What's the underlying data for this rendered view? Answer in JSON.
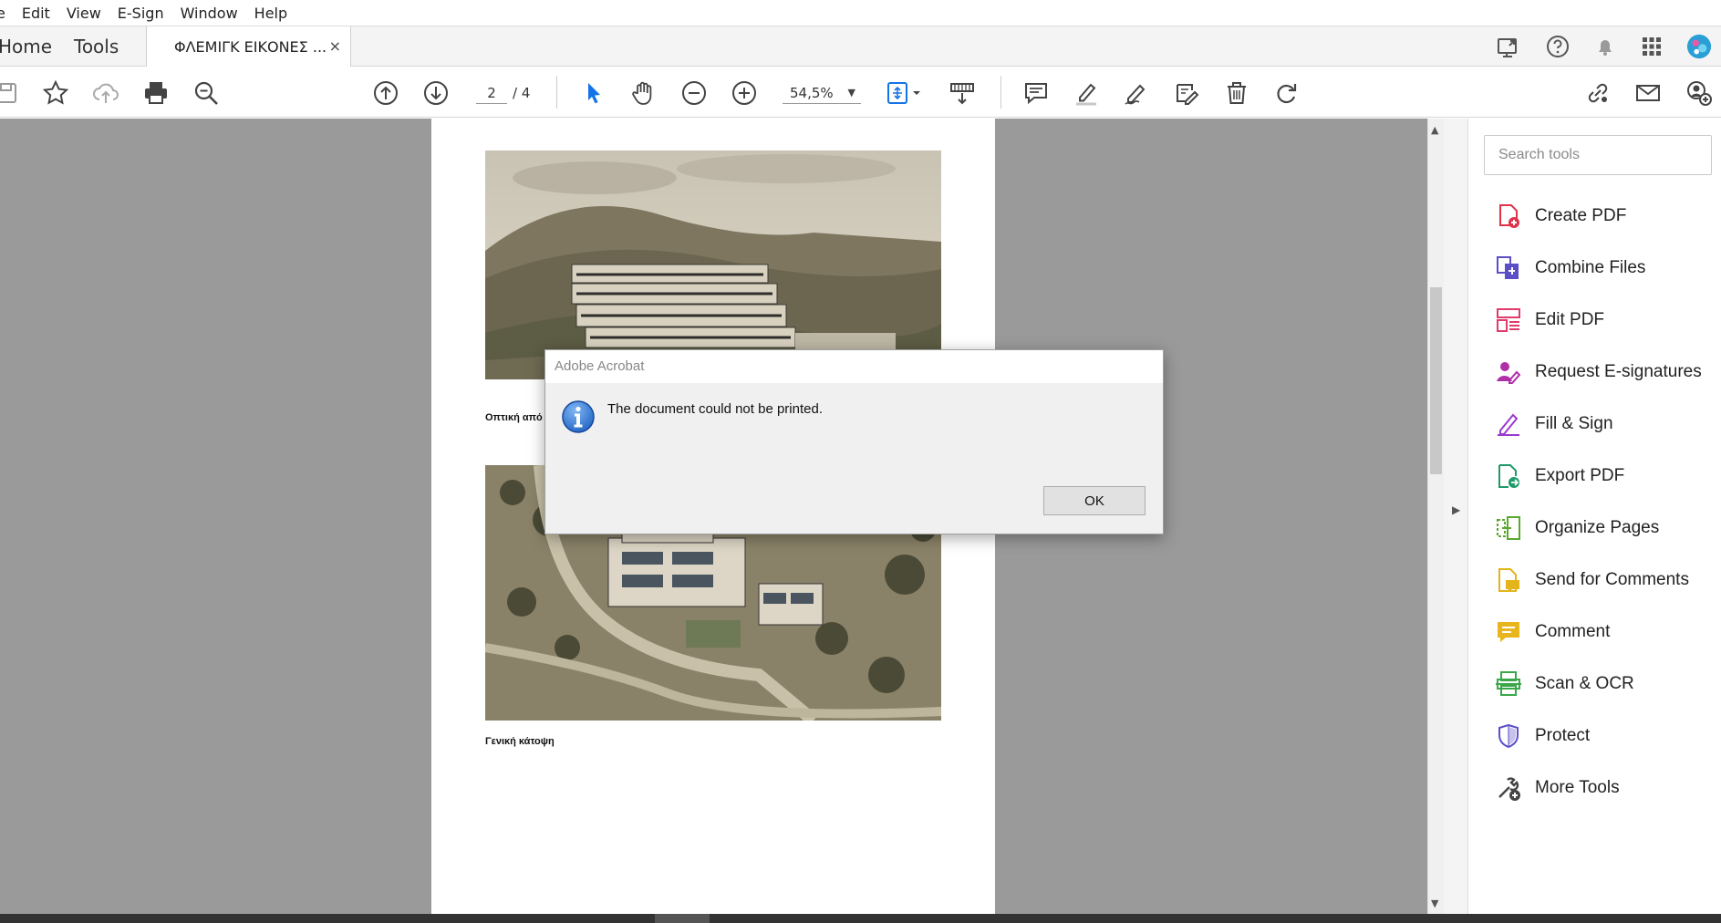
{
  "menu": {
    "items": [
      "e",
      "Edit",
      "View",
      "E-Sign",
      "Window",
      "Help"
    ]
  },
  "tabs": {
    "home": "Home",
    "tools": "Tools",
    "document": "ΦΛΕΜΙΓΚ ΕΙΚΟΝΕΣ ...",
    "close_glyph": "×"
  },
  "toolbar": {
    "page_current": "2",
    "page_total": "/ 4",
    "zoom": "54,5%",
    "zoom_caret": "▼"
  },
  "document": {
    "caption_1": "Οπτική από",
    "caption_2": "Γενική κάτοψη"
  },
  "right_panel": {
    "search_placeholder": "Search tools",
    "tools": [
      {
        "label": "Create PDF",
        "icon": "create-pdf-icon",
        "color": "#e0334a"
      },
      {
        "label": "Combine Files",
        "icon": "combine-files-icon",
        "color": "#5b4fc7"
      },
      {
        "label": "Edit PDF",
        "icon": "edit-pdf-icon",
        "color": "#e03b6b"
      },
      {
        "label": "Request E-signatures",
        "icon": "request-esign-icon",
        "color": "#b030a8"
      },
      {
        "label": "Fill & Sign",
        "icon": "fill-sign-icon",
        "color": "#9a3ad0"
      },
      {
        "label": "Export PDF",
        "icon": "export-pdf-icon",
        "color": "#1f9a6a"
      },
      {
        "label": "Organize Pages",
        "icon": "organize-pages-icon",
        "color": "#5aa82c"
      },
      {
        "label": "Send for Comments",
        "icon": "send-comments-icon",
        "color": "#e3b51a"
      },
      {
        "label": "Comment",
        "icon": "comment-icon",
        "color": "#e8b61a"
      },
      {
        "label": "Scan & OCR",
        "icon": "scan-ocr-icon",
        "color": "#3aa84a"
      },
      {
        "label": "Protect",
        "icon": "protect-icon",
        "color": "#5b4fc7"
      },
      {
        "label": "More Tools",
        "icon": "more-tools-icon",
        "color": "#444444"
      }
    ]
  },
  "dialog": {
    "title": "Adobe Acrobat",
    "message": "The document could not be printed.",
    "ok_label": "OK"
  },
  "colors": {
    "accent_blue": "#1473e6",
    "doc_background": "#9a9a9a",
    "info_blue": "#1d5fbf"
  }
}
